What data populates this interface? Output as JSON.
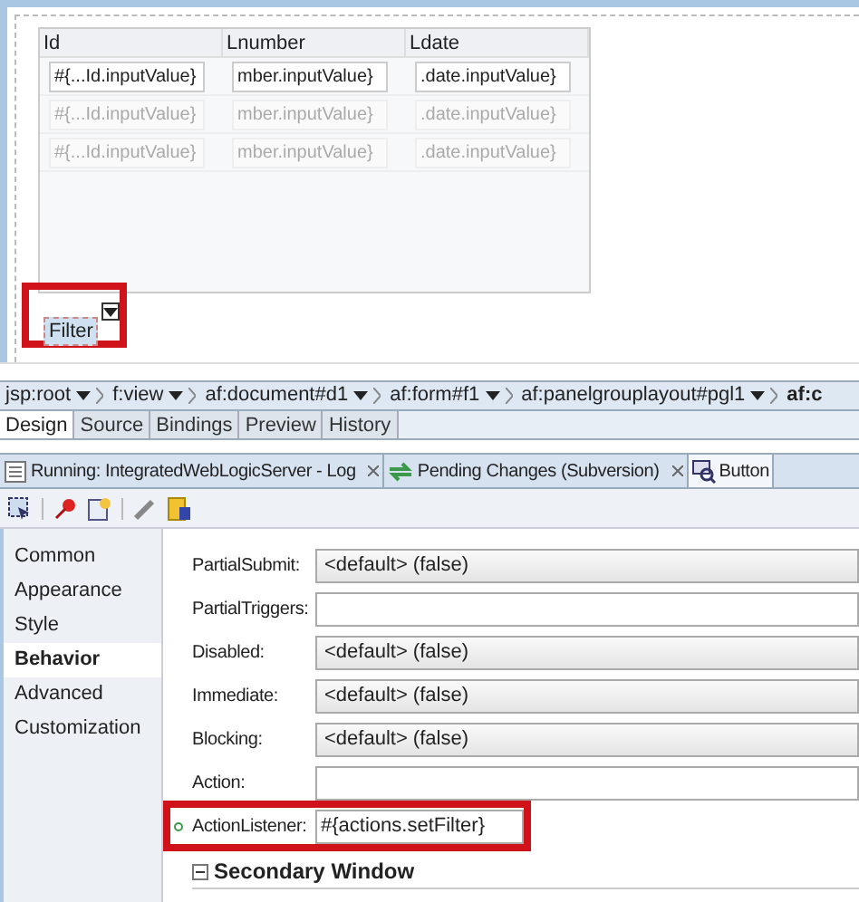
{
  "table": {
    "columns": [
      "Id",
      "Lnumber",
      "Ldate"
    ],
    "rows": [
      {
        "cells": [
          "#{...Id.inputValue}",
          "mber.inputValue}",
          ".date.inputValue}"
        ],
        "disabled": false
      },
      {
        "cells": [
          "#{...Id.inputValue}",
          "mber.inputValue}",
          ".date.inputValue}"
        ],
        "disabled": true
      },
      {
        "cells": [
          "#{...Id.inputValue}",
          "mber.inputValue}",
          ".date.inputValue}"
        ],
        "disabled": true
      }
    ]
  },
  "filter_button": {
    "label": "Filter",
    "highlighted": true
  },
  "breadcrumb": [
    "jsp:root",
    "f:view",
    "af:document#d1",
    "af:form#f1",
    "af:panelgrouplayout#pgl1",
    "af:c"
  ],
  "editor_tabs": [
    {
      "label": "Design",
      "selected": true
    },
    {
      "label": "Source",
      "selected": false
    },
    {
      "label": "Bindings",
      "selected": false
    },
    {
      "label": "Preview",
      "selected": false
    },
    {
      "label": "History",
      "selected": false
    }
  ],
  "panel_tabs": [
    {
      "label": "Running: IntegratedWebLogicServer - Log",
      "selected": false,
      "closable": true
    },
    {
      "label": "Pending Changes (Subversion)",
      "selected": false,
      "closable": true
    },
    {
      "label": "Button",
      "selected": true,
      "closable": false
    }
  ],
  "categories": [
    {
      "label": "Common",
      "selected": false
    },
    {
      "label": "Appearance",
      "selected": false
    },
    {
      "label": "Style",
      "selected": false
    },
    {
      "label": "Behavior",
      "selected": true
    },
    {
      "label": "Advanced",
      "selected": false
    },
    {
      "label": "Customization",
      "selected": false
    }
  ],
  "properties": [
    {
      "label": "PartialSubmit:",
      "kind": "dropdown",
      "value": "<default> (false)",
      "set": false,
      "highlighted": false
    },
    {
      "label": "PartialTriggers:",
      "kind": "text",
      "set": false,
      "highlighted": false
    },
    {
      "label": "Disabled:",
      "kind": "dropdown",
      "value": "<default> (false)",
      "set": false,
      "highlighted": false
    },
    {
      "label": "Immediate:",
      "kind": "dropdown",
      "value": "<default> (false)",
      "set": false,
      "highlighted": false
    },
    {
      "label": "Blocking:",
      "kind": "dropdown",
      "value": "<default> (false)",
      "set": false,
      "highlighted": false
    },
    {
      "label": "Action:",
      "kind": "text",
      "set": false,
      "highlighted": false
    },
    {
      "label": "ActionListener:",
      "kind": "text",
      "value": "#{actions.setFilter}",
      "set": true,
      "highlighted": true
    }
  ],
  "section": {
    "title": "Secondary Window",
    "expanded": true
  }
}
